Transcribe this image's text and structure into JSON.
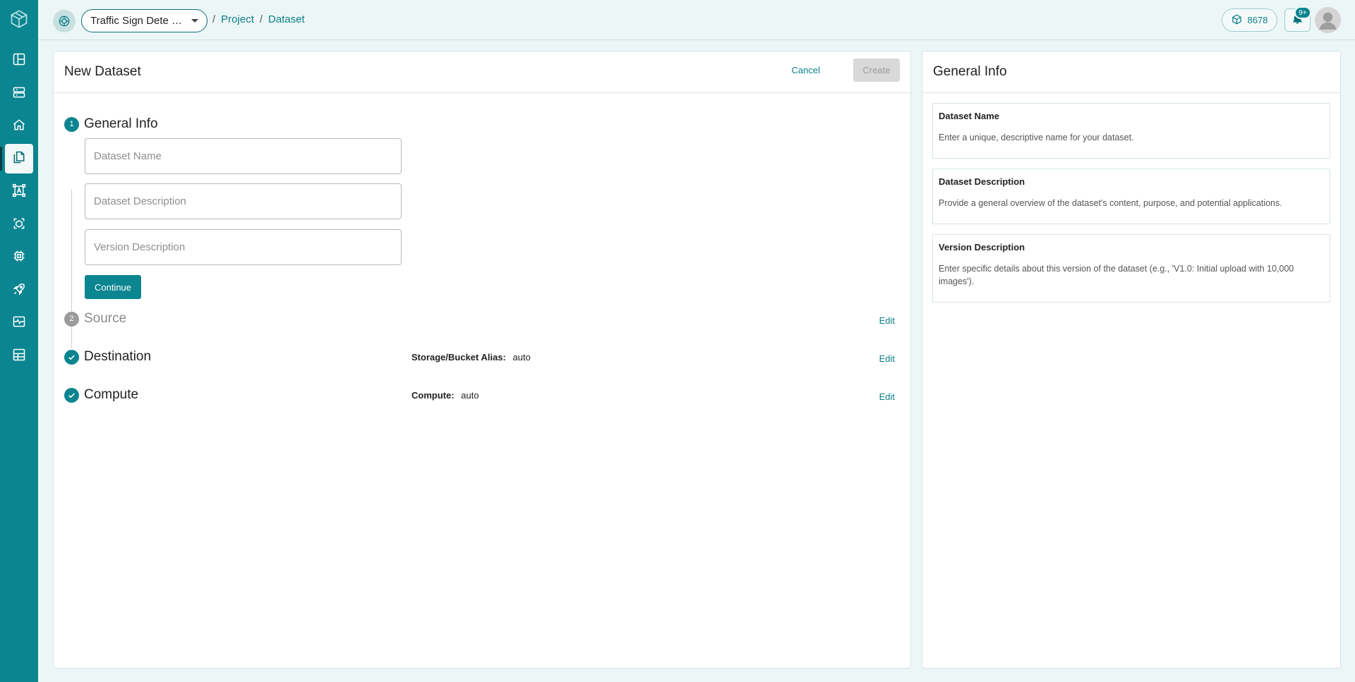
{
  "sidebar": {
    "logo_icon": "cube-logo-icon",
    "items": [
      {
        "icon": "layout-icon",
        "active": false
      },
      {
        "icon": "server-icon",
        "active": false
      },
      {
        "icon": "home-icon",
        "active": false
      },
      {
        "icon": "files-icon",
        "active": true
      },
      {
        "icon": "annotate-icon",
        "active": false
      },
      {
        "icon": "model-icon",
        "active": false
      },
      {
        "icon": "chip-icon",
        "active": false
      },
      {
        "icon": "rocket-icon",
        "active": false
      },
      {
        "icon": "monitor-icon",
        "active": false
      },
      {
        "icon": "grid-icon",
        "active": false
      }
    ]
  },
  "header": {
    "project_select": "Traffic Sign Dete …",
    "breadcrumb": [
      {
        "label": "Project"
      },
      {
        "label": "Dataset"
      }
    ],
    "separator": "/",
    "credits": "8678",
    "notification_badge": "9+"
  },
  "main": {
    "title": "New Dataset",
    "cancel_label": "Cancel",
    "create_label": "Create",
    "steps": {
      "general": {
        "num": "1",
        "title": "General Info"
      },
      "source": {
        "num": "2",
        "title": "Source",
        "edit": "Edit"
      },
      "destination": {
        "title": "Destination",
        "key": "Storage/Bucket Alias:",
        "value": "auto",
        "edit": "Edit"
      },
      "compute": {
        "title": "Compute",
        "key": "Compute:",
        "value": "auto",
        "edit": "Edit"
      }
    },
    "fields": {
      "name_placeholder": "Dataset Name",
      "desc_placeholder": "Dataset Description",
      "version_placeholder": "Version Description",
      "name_value": "",
      "desc_value": "",
      "version_value": ""
    },
    "continue_label": "Continue"
  },
  "side": {
    "title": "General Info",
    "boxes": [
      {
        "title": "Dataset Name",
        "text": "Enter a unique, descriptive name for your dataset."
      },
      {
        "title": "Dataset Description",
        "text": "Provide a general overview of the dataset's content, purpose, and potential applications."
      },
      {
        "title": "Version Description",
        "text": "Enter specific details about this version of the dataset (e.g., 'V1.0: Initial upload with 10,000 images')."
      }
    ]
  },
  "colors": {
    "accent": "#0b8590",
    "sidebar_bg": "#0b8590",
    "page_bg": "#edf6f6"
  }
}
